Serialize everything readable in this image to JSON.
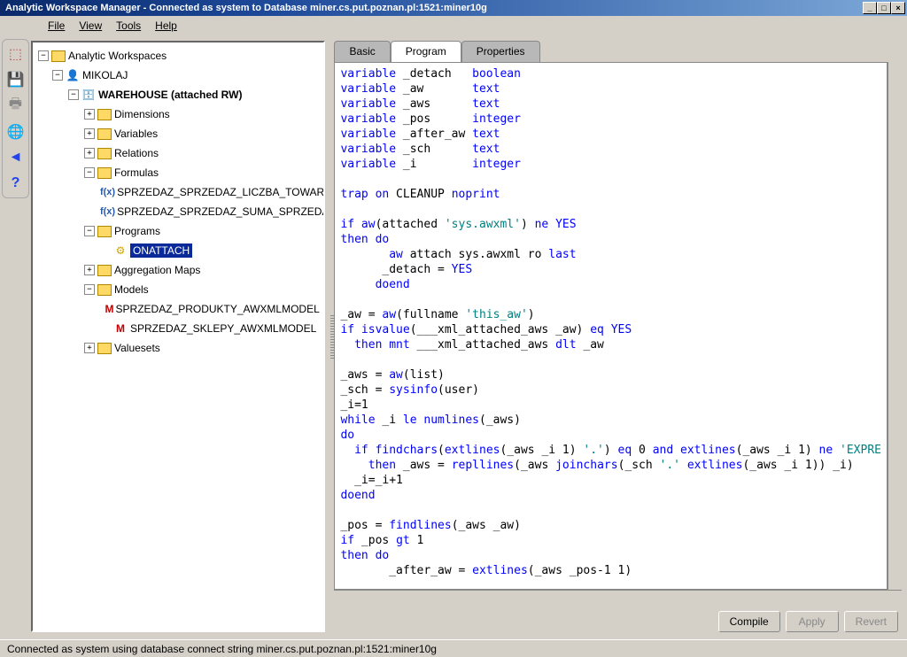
{
  "title": "Analytic Workspace Manager - Connected as system to Database miner.cs.put.poznan.pl:1521:miner10g",
  "menu": {
    "file": "File",
    "view": "View",
    "tools": "Tools",
    "help": "Help"
  },
  "tree": {
    "root": "Analytic Workspaces",
    "user": "MIKOLAJ",
    "warehouse": "WAREHOUSE (attached RW)",
    "dimensions": "Dimensions",
    "variables": "Variables",
    "relations": "Relations",
    "formulas": "Formulas",
    "formula1": "SPRZEDAZ_SPRZEDAZ_LICZBA_TOWAROW",
    "formula2": "SPRZEDAZ_SPRZEDAZ_SUMA_SPRZEDAZY",
    "programs": "Programs",
    "onattach": "ONATTACH",
    "aggmaps": "Aggregation Maps",
    "models": "Models",
    "model1": "SPRZEDAZ_PRODUKTY_AWXMLMODEL",
    "model2": "SPRZEDAZ_SKLEPY_AWXMLMODEL",
    "valuesets": "Valuesets"
  },
  "tabs": {
    "basic": "Basic",
    "program": "Program",
    "properties": "Properties"
  },
  "code": {
    "tokens": [
      [
        [
          "kw",
          "variable"
        ],
        [
          "",
          " _detach   "
        ],
        [
          "kw",
          "boolean"
        ]
      ],
      [
        [
          "kw",
          "variable"
        ],
        [
          "",
          " _aw       "
        ],
        [
          "kw",
          "text"
        ]
      ],
      [
        [
          "kw",
          "variable"
        ],
        [
          "",
          " _aws      "
        ],
        [
          "kw",
          "text"
        ]
      ],
      [
        [
          "kw",
          "variable"
        ],
        [
          "",
          " _pos      "
        ],
        [
          "kw",
          "integer"
        ]
      ],
      [
        [
          "kw",
          "variable"
        ],
        [
          "",
          " _after_aw "
        ],
        [
          "kw",
          "text"
        ]
      ],
      [
        [
          "kw",
          "variable"
        ],
        [
          "",
          " _sch      "
        ],
        [
          "kw",
          "text"
        ]
      ],
      [
        [
          "kw",
          "variable"
        ],
        [
          "",
          " _i        "
        ],
        [
          "kw",
          "integer"
        ]
      ],
      [
        [
          "",
          ""
        ]
      ],
      [
        [
          "kw",
          "trap"
        ],
        [
          "",
          " "
        ],
        [
          "kw",
          "on"
        ],
        [
          "",
          " CLEANUP "
        ],
        [
          "kw",
          "noprint"
        ]
      ],
      [
        [
          "",
          ""
        ]
      ],
      [
        [
          "kw",
          "if"
        ],
        [
          "",
          " "
        ],
        [
          "kw",
          "aw"
        ],
        [
          "",
          "(attached "
        ],
        [
          "str",
          "'sys.awxml'"
        ],
        [
          "",
          ") "
        ],
        [
          "kw",
          "ne"
        ],
        [
          "",
          " "
        ],
        [
          "kw",
          "YES"
        ]
      ],
      [
        [
          "kw",
          "then"
        ],
        [
          "",
          " "
        ],
        [
          "kw",
          "do"
        ]
      ],
      [
        [
          "",
          "       "
        ],
        [
          "kw",
          "aw"
        ],
        [
          "",
          " attach sys.awxml ro "
        ],
        [
          "kw",
          "last"
        ]
      ],
      [
        [
          "",
          "      _detach = "
        ],
        [
          "kw",
          "YES"
        ]
      ],
      [
        [
          "",
          "     "
        ],
        [
          "kw",
          "doend"
        ]
      ],
      [
        [
          "",
          ""
        ]
      ],
      [
        [
          "",
          "_aw = "
        ],
        [
          "kw",
          "aw"
        ],
        [
          "",
          "(fullname "
        ],
        [
          "str",
          "'this_aw'"
        ],
        [
          "",
          ")"
        ]
      ],
      [
        [
          "kw",
          "if"
        ],
        [
          "",
          " "
        ],
        [
          "kw",
          "isvalue"
        ],
        [
          "",
          "(___xml_attached_aws _aw) "
        ],
        [
          "kw",
          "eq"
        ],
        [
          "",
          " "
        ],
        [
          "kw",
          "YES"
        ]
      ],
      [
        [
          "",
          "  "
        ],
        [
          "kw",
          "then"
        ],
        [
          "",
          " "
        ],
        [
          "kw",
          "mnt"
        ],
        [
          "",
          " ___xml_attached_aws "
        ],
        [
          "kw",
          "dlt"
        ],
        [
          "",
          " _aw"
        ]
      ],
      [
        [
          "",
          ""
        ]
      ],
      [
        [
          "",
          "_aws = "
        ],
        [
          "kw",
          "aw"
        ],
        [
          "",
          "(list)"
        ]
      ],
      [
        [
          "",
          "_sch = "
        ],
        [
          "kw",
          "sysinfo"
        ],
        [
          "",
          "(user)"
        ]
      ],
      [
        [
          "",
          "_i=1"
        ]
      ],
      [
        [
          "kw",
          "while"
        ],
        [
          "",
          " _i "
        ],
        [
          "kw",
          "le"
        ],
        [
          "",
          " "
        ],
        [
          "kw",
          "numlines"
        ],
        [
          "",
          "(_aws)"
        ]
      ],
      [
        [
          "kw",
          "do"
        ]
      ],
      [
        [
          "",
          "  "
        ],
        [
          "kw",
          "if"
        ],
        [
          "",
          " "
        ],
        [
          "kw",
          "findchars"
        ],
        [
          "",
          "("
        ],
        [
          "kw",
          "extlines"
        ],
        [
          "",
          "(_aws _i 1) "
        ],
        [
          "str",
          "'.'"
        ],
        [
          "",
          ") "
        ],
        [
          "kw",
          "eq"
        ],
        [
          "",
          " 0 "
        ],
        [
          "kw",
          "and"
        ],
        [
          "",
          " "
        ],
        [
          "kw",
          "extlines"
        ],
        [
          "",
          "(_aws _i 1) "
        ],
        [
          "kw",
          "ne"
        ],
        [
          "",
          " "
        ],
        [
          "str",
          "'EXPRE"
        ]
      ],
      [
        [
          "",
          "    "
        ],
        [
          "kw",
          "then"
        ],
        [
          "",
          " _aws = "
        ],
        [
          "kw",
          "repllines"
        ],
        [
          "",
          "(_aws "
        ],
        [
          "kw",
          "joinchars"
        ],
        [
          "",
          "(_sch "
        ],
        [
          "str",
          "'.'"
        ],
        [
          "",
          " "
        ],
        [
          "kw",
          "extlines"
        ],
        [
          "",
          "(_aws _i 1)) _i)"
        ]
      ],
      [
        [
          "",
          "  _i=_i+1"
        ]
      ],
      [
        [
          "kw",
          "doend"
        ]
      ],
      [
        [
          "",
          ""
        ]
      ],
      [
        [
          "",
          "_pos = "
        ],
        [
          "kw",
          "findlines"
        ],
        [
          "",
          "(_aws _aw)"
        ]
      ],
      [
        [
          "kw",
          "if"
        ],
        [
          "",
          " _pos "
        ],
        [
          "kw",
          "gt"
        ],
        [
          "",
          " 1"
        ]
      ],
      [
        [
          "kw",
          "then"
        ],
        [
          "",
          " "
        ],
        [
          "kw",
          "do"
        ]
      ],
      [
        [
          "",
          "       _after_aw = "
        ],
        [
          "kw",
          "extlines"
        ],
        [
          "",
          "(_aws _pos-1 1)"
        ]
      ]
    ]
  },
  "buttons": {
    "compile": "Compile",
    "apply": "Apply",
    "revert": "Revert"
  },
  "status": "Connected as system using database connect string miner.cs.put.poznan.pl:1521:miner10g"
}
